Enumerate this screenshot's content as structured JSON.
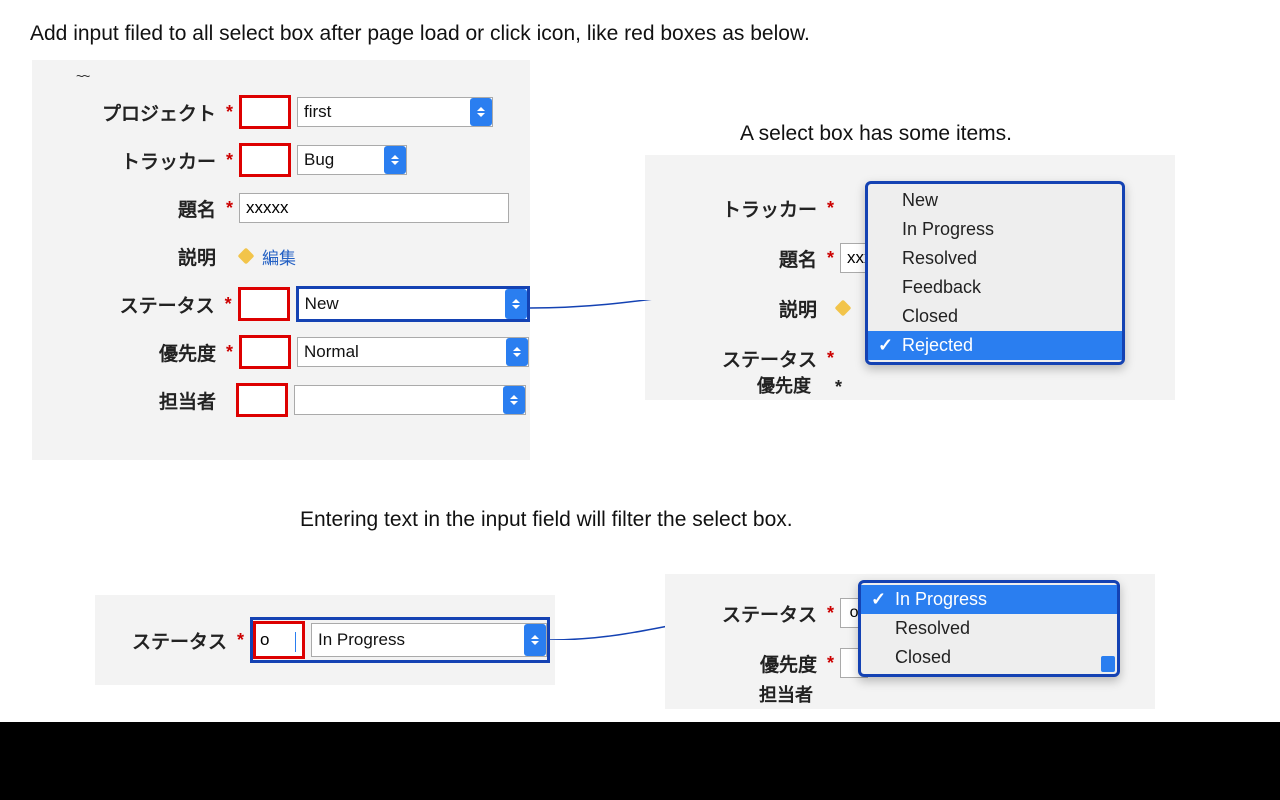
{
  "intro": "Add input filed to all select box after page load or click icon, like red boxes as below.",
  "caption_a": "A select box has some items.",
  "caption_b": "Entering text in the input field will filter the select box.",
  "panel_a": {
    "project_label": "プロジェクト",
    "project_value": "first",
    "tracker_label": "トラッカー",
    "tracker_value": "Bug",
    "subject_label": "題名",
    "subject_value": "xxxxx",
    "desc_label": "説明",
    "edit_link": "編集",
    "status_label": "ステータス",
    "status_value": "New",
    "priority_label": "優先度",
    "priority_value": "Normal",
    "assignee_label": "担当者",
    "assignee_value": ""
  },
  "panel_b": {
    "tracker_label": "トラッカー",
    "subject_label": "題名",
    "subject_value": "xxx",
    "desc_label": "説明",
    "status_label": "ステータス",
    "priority_cut": "優先度",
    "dropdown_items": [
      "New",
      "In Progress",
      "Resolved",
      "Feedback",
      "Closed",
      "Rejected"
    ],
    "dropdown_selected": "Rejected"
  },
  "panel_c": {
    "status_label": "ステータス",
    "filter_value": "o",
    "status_value": "In Progress"
  },
  "panel_d": {
    "status_label": "ステータス",
    "status_filter": "o",
    "priority_label": "優先度",
    "assignee_cut": "担当者",
    "dropdown_items": [
      "In Progress",
      "Resolved",
      "Closed"
    ],
    "dropdown_selected": "In Progress"
  }
}
